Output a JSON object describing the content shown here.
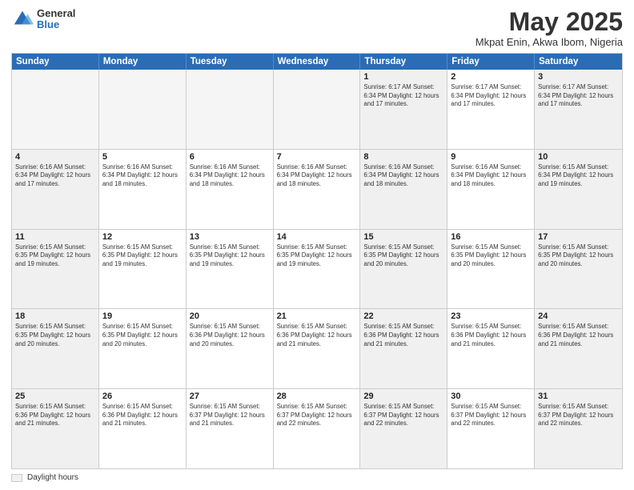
{
  "logo": {
    "general": "General",
    "blue": "Blue"
  },
  "title": "May 2025",
  "subtitle": "Mkpat Enin, Akwa Ibom, Nigeria",
  "days_of_week": [
    "Sunday",
    "Monday",
    "Tuesday",
    "Wednesday",
    "Thursday",
    "Friday",
    "Saturday"
  ],
  "legend_label": "Daylight hours",
  "weeks": [
    [
      {
        "day": "",
        "empty": true
      },
      {
        "day": "",
        "empty": true
      },
      {
        "day": "",
        "empty": true
      },
      {
        "day": "",
        "empty": true
      },
      {
        "day": "1",
        "shaded": true,
        "info": "Sunrise: 6:17 AM\nSunset: 6:34 PM\nDaylight: 12 hours\nand 17 minutes."
      },
      {
        "day": "2",
        "shaded": false,
        "info": "Sunrise: 6:17 AM\nSunset: 6:34 PM\nDaylight: 12 hours\nand 17 minutes."
      },
      {
        "day": "3",
        "shaded": true,
        "info": "Sunrise: 6:17 AM\nSunset: 6:34 PM\nDaylight: 12 hours\nand 17 minutes."
      }
    ],
    [
      {
        "day": "4",
        "shaded": true,
        "info": "Sunrise: 6:16 AM\nSunset: 6:34 PM\nDaylight: 12 hours\nand 17 minutes."
      },
      {
        "day": "5",
        "shaded": false,
        "info": "Sunrise: 6:16 AM\nSunset: 6:34 PM\nDaylight: 12 hours\nand 18 minutes."
      },
      {
        "day": "6",
        "shaded": false,
        "info": "Sunrise: 6:16 AM\nSunset: 6:34 PM\nDaylight: 12 hours\nand 18 minutes."
      },
      {
        "day": "7",
        "shaded": false,
        "info": "Sunrise: 6:16 AM\nSunset: 6:34 PM\nDaylight: 12 hours\nand 18 minutes."
      },
      {
        "day": "8",
        "shaded": true,
        "info": "Sunrise: 6:16 AM\nSunset: 6:34 PM\nDaylight: 12 hours\nand 18 minutes."
      },
      {
        "day": "9",
        "shaded": false,
        "info": "Sunrise: 6:16 AM\nSunset: 6:34 PM\nDaylight: 12 hours\nand 18 minutes."
      },
      {
        "day": "10",
        "shaded": true,
        "info": "Sunrise: 6:15 AM\nSunset: 6:34 PM\nDaylight: 12 hours\nand 19 minutes."
      }
    ],
    [
      {
        "day": "11",
        "shaded": true,
        "info": "Sunrise: 6:15 AM\nSunset: 6:35 PM\nDaylight: 12 hours\nand 19 minutes."
      },
      {
        "day": "12",
        "shaded": false,
        "info": "Sunrise: 6:15 AM\nSunset: 6:35 PM\nDaylight: 12 hours\nand 19 minutes."
      },
      {
        "day": "13",
        "shaded": false,
        "info": "Sunrise: 6:15 AM\nSunset: 6:35 PM\nDaylight: 12 hours\nand 19 minutes."
      },
      {
        "day": "14",
        "shaded": false,
        "info": "Sunrise: 6:15 AM\nSunset: 6:35 PM\nDaylight: 12 hours\nand 19 minutes."
      },
      {
        "day": "15",
        "shaded": true,
        "info": "Sunrise: 6:15 AM\nSunset: 6:35 PM\nDaylight: 12 hours\nand 20 minutes."
      },
      {
        "day": "16",
        "shaded": false,
        "info": "Sunrise: 6:15 AM\nSunset: 6:35 PM\nDaylight: 12 hours\nand 20 minutes."
      },
      {
        "day": "17",
        "shaded": true,
        "info": "Sunrise: 6:15 AM\nSunset: 6:35 PM\nDaylight: 12 hours\nand 20 minutes."
      }
    ],
    [
      {
        "day": "18",
        "shaded": true,
        "info": "Sunrise: 6:15 AM\nSunset: 6:35 PM\nDaylight: 12 hours\nand 20 minutes."
      },
      {
        "day": "19",
        "shaded": false,
        "info": "Sunrise: 6:15 AM\nSunset: 6:35 PM\nDaylight: 12 hours\nand 20 minutes."
      },
      {
        "day": "20",
        "shaded": false,
        "info": "Sunrise: 6:15 AM\nSunset: 6:36 PM\nDaylight: 12 hours\nand 20 minutes."
      },
      {
        "day": "21",
        "shaded": false,
        "info": "Sunrise: 6:15 AM\nSunset: 6:36 PM\nDaylight: 12 hours\nand 21 minutes."
      },
      {
        "day": "22",
        "shaded": true,
        "info": "Sunrise: 6:15 AM\nSunset: 6:36 PM\nDaylight: 12 hours\nand 21 minutes."
      },
      {
        "day": "23",
        "shaded": false,
        "info": "Sunrise: 6:15 AM\nSunset: 6:36 PM\nDaylight: 12 hours\nand 21 minutes."
      },
      {
        "day": "24",
        "shaded": true,
        "info": "Sunrise: 6:15 AM\nSunset: 6:36 PM\nDaylight: 12 hours\nand 21 minutes."
      }
    ],
    [
      {
        "day": "25",
        "shaded": true,
        "info": "Sunrise: 6:15 AM\nSunset: 6:36 PM\nDaylight: 12 hours\nand 21 minutes."
      },
      {
        "day": "26",
        "shaded": false,
        "info": "Sunrise: 6:15 AM\nSunset: 6:36 PM\nDaylight: 12 hours\nand 21 minutes."
      },
      {
        "day": "27",
        "shaded": false,
        "info": "Sunrise: 6:15 AM\nSunset: 6:37 PM\nDaylight: 12 hours\nand 21 minutes."
      },
      {
        "day": "28",
        "shaded": false,
        "info": "Sunrise: 6:15 AM\nSunset: 6:37 PM\nDaylight: 12 hours\nand 22 minutes."
      },
      {
        "day": "29",
        "shaded": true,
        "info": "Sunrise: 6:15 AM\nSunset: 6:37 PM\nDaylight: 12 hours\nand 22 minutes."
      },
      {
        "day": "30",
        "shaded": false,
        "info": "Sunrise: 6:15 AM\nSunset: 6:37 PM\nDaylight: 12 hours\nand 22 minutes."
      },
      {
        "day": "31",
        "shaded": true,
        "info": "Sunrise: 6:15 AM\nSunset: 6:37 PM\nDaylight: 12 hours\nand 22 minutes."
      }
    ]
  ]
}
